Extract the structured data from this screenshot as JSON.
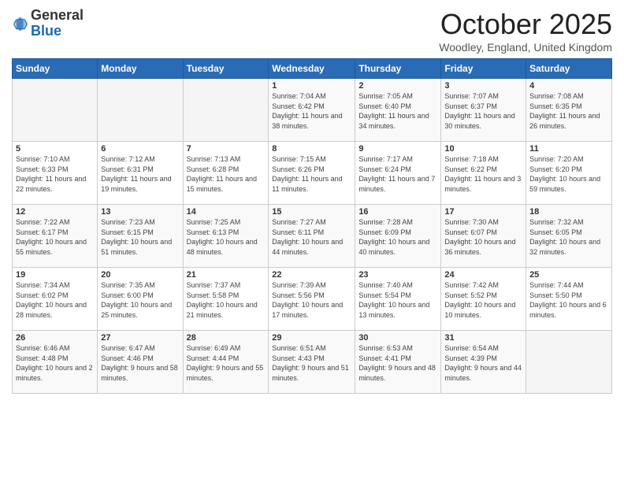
{
  "logo": {
    "general": "General",
    "blue": "Blue"
  },
  "header": {
    "month": "October 2025",
    "location": "Woodley, England, United Kingdom"
  },
  "weekdays": [
    "Sunday",
    "Monday",
    "Tuesday",
    "Wednesday",
    "Thursday",
    "Friday",
    "Saturday"
  ],
  "weeks": [
    [
      {
        "day": "",
        "info": ""
      },
      {
        "day": "",
        "info": ""
      },
      {
        "day": "",
        "info": ""
      },
      {
        "day": "1",
        "info": "Sunrise: 7:04 AM\nSunset: 6:42 PM\nDaylight: 11 hours\nand 38 minutes."
      },
      {
        "day": "2",
        "info": "Sunrise: 7:05 AM\nSunset: 6:40 PM\nDaylight: 11 hours\nand 34 minutes."
      },
      {
        "day": "3",
        "info": "Sunrise: 7:07 AM\nSunset: 6:37 PM\nDaylight: 11 hours\nand 30 minutes."
      },
      {
        "day": "4",
        "info": "Sunrise: 7:08 AM\nSunset: 6:35 PM\nDaylight: 11 hours\nand 26 minutes."
      }
    ],
    [
      {
        "day": "5",
        "info": "Sunrise: 7:10 AM\nSunset: 6:33 PM\nDaylight: 11 hours\nand 22 minutes."
      },
      {
        "day": "6",
        "info": "Sunrise: 7:12 AM\nSunset: 6:31 PM\nDaylight: 11 hours\nand 19 minutes."
      },
      {
        "day": "7",
        "info": "Sunrise: 7:13 AM\nSunset: 6:28 PM\nDaylight: 11 hours\nand 15 minutes."
      },
      {
        "day": "8",
        "info": "Sunrise: 7:15 AM\nSunset: 6:26 PM\nDaylight: 11 hours\nand 11 minutes."
      },
      {
        "day": "9",
        "info": "Sunrise: 7:17 AM\nSunset: 6:24 PM\nDaylight: 11 hours\nand 7 minutes."
      },
      {
        "day": "10",
        "info": "Sunrise: 7:18 AM\nSunset: 6:22 PM\nDaylight: 11 hours\nand 3 minutes."
      },
      {
        "day": "11",
        "info": "Sunrise: 7:20 AM\nSunset: 6:20 PM\nDaylight: 10 hours\nand 59 minutes."
      }
    ],
    [
      {
        "day": "12",
        "info": "Sunrise: 7:22 AM\nSunset: 6:17 PM\nDaylight: 10 hours\nand 55 minutes."
      },
      {
        "day": "13",
        "info": "Sunrise: 7:23 AM\nSunset: 6:15 PM\nDaylight: 10 hours\nand 51 minutes."
      },
      {
        "day": "14",
        "info": "Sunrise: 7:25 AM\nSunset: 6:13 PM\nDaylight: 10 hours\nand 48 minutes."
      },
      {
        "day": "15",
        "info": "Sunrise: 7:27 AM\nSunset: 6:11 PM\nDaylight: 10 hours\nand 44 minutes."
      },
      {
        "day": "16",
        "info": "Sunrise: 7:28 AM\nSunset: 6:09 PM\nDaylight: 10 hours\nand 40 minutes."
      },
      {
        "day": "17",
        "info": "Sunrise: 7:30 AM\nSunset: 6:07 PM\nDaylight: 10 hours\nand 36 minutes."
      },
      {
        "day": "18",
        "info": "Sunrise: 7:32 AM\nSunset: 6:05 PM\nDaylight: 10 hours\nand 32 minutes."
      }
    ],
    [
      {
        "day": "19",
        "info": "Sunrise: 7:34 AM\nSunset: 6:02 PM\nDaylight: 10 hours\nand 28 minutes."
      },
      {
        "day": "20",
        "info": "Sunrise: 7:35 AM\nSunset: 6:00 PM\nDaylight: 10 hours\nand 25 minutes."
      },
      {
        "day": "21",
        "info": "Sunrise: 7:37 AM\nSunset: 5:58 PM\nDaylight: 10 hours\nand 21 minutes."
      },
      {
        "day": "22",
        "info": "Sunrise: 7:39 AM\nSunset: 5:56 PM\nDaylight: 10 hours\nand 17 minutes."
      },
      {
        "day": "23",
        "info": "Sunrise: 7:40 AM\nSunset: 5:54 PM\nDaylight: 10 hours\nand 13 minutes."
      },
      {
        "day": "24",
        "info": "Sunrise: 7:42 AM\nSunset: 5:52 PM\nDaylight: 10 hours\nand 10 minutes."
      },
      {
        "day": "25",
        "info": "Sunrise: 7:44 AM\nSunset: 5:50 PM\nDaylight: 10 hours\nand 6 minutes."
      }
    ],
    [
      {
        "day": "26",
        "info": "Sunrise: 6:46 AM\nSunset: 4:48 PM\nDaylight: 10 hours\nand 2 minutes."
      },
      {
        "day": "27",
        "info": "Sunrise: 6:47 AM\nSunset: 4:46 PM\nDaylight: 9 hours\nand 58 minutes."
      },
      {
        "day": "28",
        "info": "Sunrise: 6:49 AM\nSunset: 4:44 PM\nDaylight: 9 hours\nand 55 minutes."
      },
      {
        "day": "29",
        "info": "Sunrise: 6:51 AM\nSunset: 4:43 PM\nDaylight: 9 hours\nand 51 minutes."
      },
      {
        "day": "30",
        "info": "Sunrise: 6:53 AM\nSunset: 4:41 PM\nDaylight: 9 hours\nand 48 minutes."
      },
      {
        "day": "31",
        "info": "Sunrise: 6:54 AM\nSunset: 4:39 PM\nDaylight: 9 hours\nand 44 minutes."
      },
      {
        "day": "",
        "info": ""
      }
    ]
  ]
}
